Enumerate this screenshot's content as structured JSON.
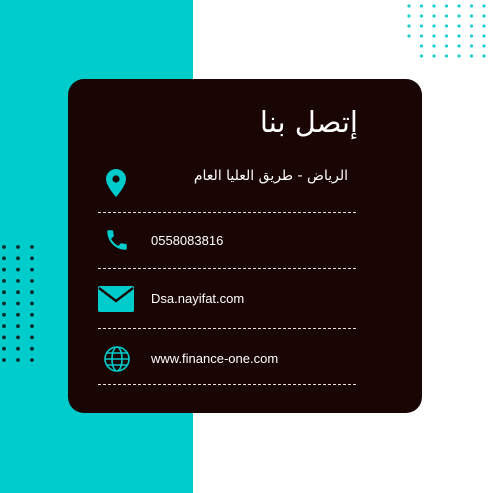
{
  "contact_card": {
    "title": "إتصل بنا",
    "address": "الرياض - طريق العليا العام",
    "phone": "0558083816",
    "email": "Dsa.nayifat.com",
    "website": "www.finance-one.com"
  },
  "colors": {
    "accent": "#00cccc",
    "card_background": "#1a0505",
    "text": "#ffffff",
    "dots_dark": "#0a2a2a"
  },
  "icons": {
    "address": "location-pin-icon",
    "phone": "phone-icon",
    "email": "envelope-icon",
    "website": "globe-icon"
  }
}
